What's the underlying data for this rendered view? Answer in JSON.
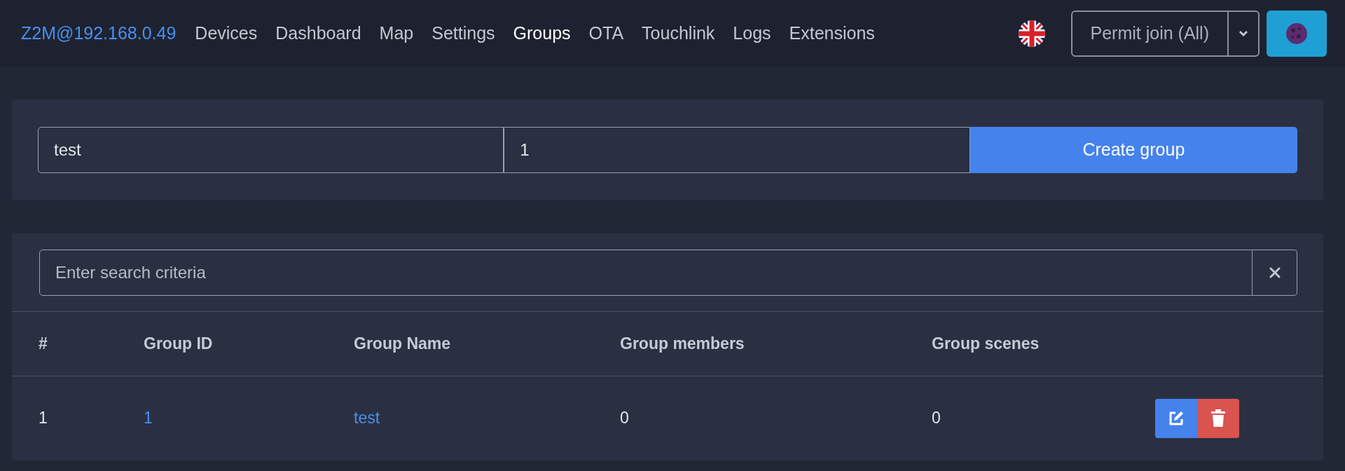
{
  "navbar": {
    "brand": "Z2M@192.168.0.49",
    "items": [
      {
        "label": "Devices",
        "selected": false
      },
      {
        "label": "Dashboard",
        "selected": false
      },
      {
        "label": "Map",
        "selected": false
      },
      {
        "label": "Settings",
        "selected": false
      },
      {
        "label": "Groups",
        "selected": true
      },
      {
        "label": "OTA",
        "selected": false
      },
      {
        "label": "Touchlink",
        "selected": false
      },
      {
        "label": "Logs",
        "selected": false
      },
      {
        "label": "Extensions",
        "selected": false
      }
    ],
    "permit_join": "Permit join (All)"
  },
  "create_form": {
    "name_value": "test",
    "id_value": "1",
    "button": "Create group"
  },
  "search": {
    "placeholder": "Enter search criteria"
  },
  "table": {
    "columns": [
      "#",
      "Group ID",
      "Group Name",
      "Group members",
      "Group scenes"
    ],
    "rows": [
      {
        "index": "1",
        "group_id": "1",
        "group_name": "test",
        "members": "0",
        "scenes": "0"
      }
    ]
  }
}
